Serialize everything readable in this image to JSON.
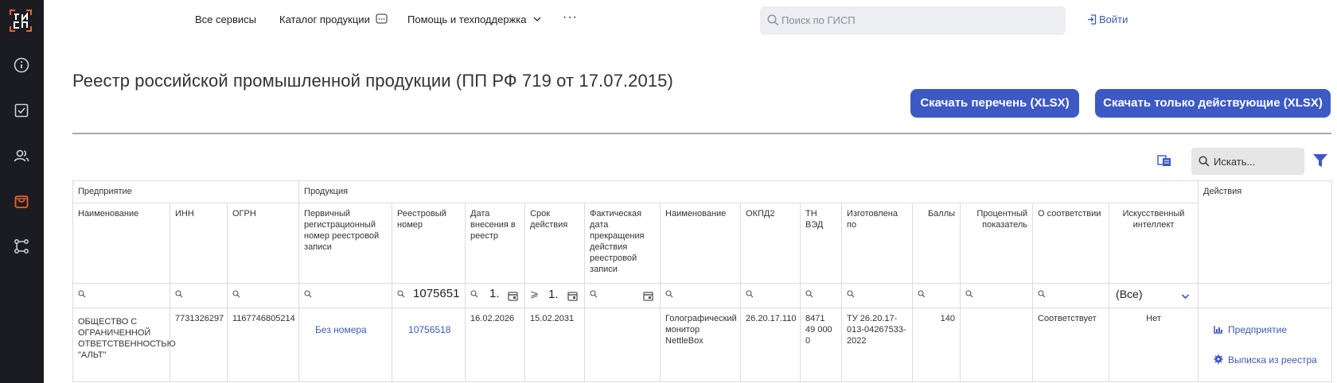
{
  "app": {
    "logo_text": "ГИСП"
  },
  "nav": {
    "all_services": "Все сервисы",
    "catalog": "Каталог продукции",
    "help": "Помощь и техподдержка",
    "more": "···",
    "search_placeholder": "Поиск по ГИСП",
    "login": "Войти"
  },
  "page": {
    "title": "Реестр российской промышленной продукции (ПП РФ 719 от 17.07.2015)",
    "btn_download_list": "Скачать перечень (XLSX)",
    "btn_download_active": "Скачать только действующие (XLSX)",
    "table_search_placeholder": "Искать..."
  },
  "table": {
    "bands": {
      "enterprise": "Предприятие",
      "product": "Продукция",
      "actions": "Действия"
    },
    "headers": [
      "Наименование",
      "ИНН",
      "ОГРН",
      "Первичный регистрационный номер реестровой записи",
      "Реестровый номер",
      "Дата внесения в реестр",
      "Срок действия",
      "Фактическая дата прекращения действия реестровой записи",
      "Наименование",
      "ОКПД2",
      "ТН ВЭД",
      "Изготовлена по",
      "Баллы",
      "Процентный показатель",
      "О соответствии",
      "Искусственный интеллект"
    ],
    "filters": {
      "reg_number": "1075651",
      "date_added": "1.",
      "validity_op": "⩾",
      "validity": "1.",
      "ai_select": "(Все)"
    },
    "rows": [
      {
        "name": "ОБЩЕСТВО С ОГРАНИЧЕННОЙ ОТВЕТСТВЕННОСТЬЮ \"АЛЬТ\"",
        "inn": "7731326297",
        "ogrn": "1167746805214",
        "primary_number": "Без номера",
        "reg_number": "10756518",
        "date_added": "16.02.2026",
        "validity": "15.02.2031",
        "end_date": "",
        "product_name": "Голографический монитор NettleBox",
        "okpd2": "26.20.17.110",
        "tnved": "8471 49 000 0",
        "made_by": "ТУ 26.20.17-013-04267533-2022",
        "score": "140",
        "percent": "",
        "conformity": "Соответствует",
        "ai": "Нет",
        "action_enterprise": "Предприятие",
        "action_extract": "Выписка из реестра"
      }
    ]
  },
  "colors": {
    "accent": "#3d59c4",
    "sidebar": "#1b1b22",
    "sidebar_active": "#e8642c"
  }
}
